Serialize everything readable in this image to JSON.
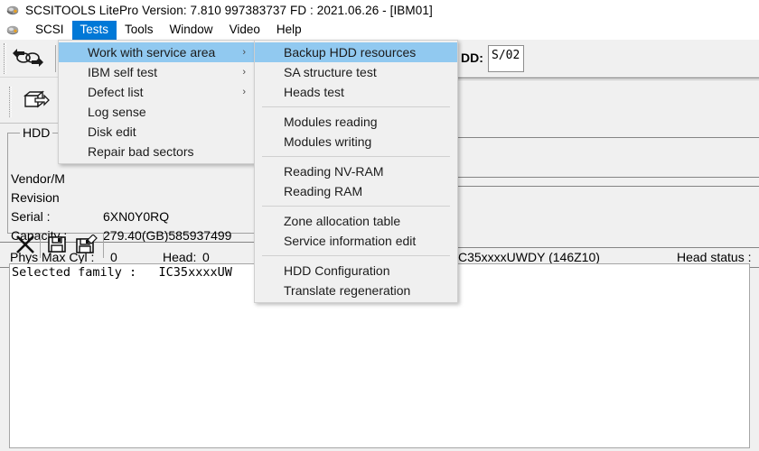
{
  "window": {
    "icon": "scsitools-app-icon",
    "title": "SCSITOOLS LitePro Version: 7.810   997383737  FD : 2021.06.26 - [IBM01]"
  },
  "menubar": {
    "icon": "scsi-doc-icon",
    "items": [
      {
        "label": "SCSI",
        "active": false
      },
      {
        "label": "Tests",
        "active": true
      },
      {
        "label": "Tools",
        "active": false
      },
      {
        "label": "Window",
        "active": false
      },
      {
        "label": "Video",
        "active": false
      },
      {
        "label": "Help",
        "active": false
      }
    ]
  },
  "toolbar": {
    "buttons": [
      {
        "icon": "swap-arrows-icon",
        "name": "rescan-bus-button"
      },
      {
        "icon": "select-drive-icon",
        "name": "select-drive-button"
      }
    ]
  },
  "tests_menu": {
    "items": [
      {
        "label": "Work with service area",
        "submenu": true,
        "highlighted": true
      },
      {
        "label": "IBM self test",
        "submenu": true,
        "highlighted": false
      },
      {
        "label": "Defect list",
        "submenu": true,
        "highlighted": false
      },
      {
        "label": "Log sense",
        "submenu": false,
        "highlighted": false
      },
      {
        "label": "Disk edit",
        "submenu": false,
        "highlighted": false
      },
      {
        "label": "Repair bad sectors",
        "submenu": false,
        "highlighted": false
      }
    ]
  },
  "service_area_menu": {
    "groups": [
      [
        {
          "label": "Backup HDD resources",
          "highlighted": true
        },
        {
          "label": "SA structure test",
          "highlighted": false
        },
        {
          "label": "Heads test",
          "highlighted": false
        }
      ],
      [
        {
          "label": "Modules reading",
          "highlighted": false
        },
        {
          "label": "Modules writing",
          "highlighted": false
        }
      ],
      [
        {
          "label": "Reading NV-RAM",
          "highlighted": false
        },
        {
          "label": "Reading RAM",
          "highlighted": false
        }
      ],
      [
        {
          "label": "Zone allocation table",
          "highlighted": false
        },
        {
          "label": "Service information edit",
          "highlighted": false
        }
      ],
      [
        {
          "label": "HDD Configuration",
          "highlighted": false
        },
        {
          "label": "Translate regeneration",
          "highlighted": false
        }
      ]
    ]
  },
  "hdd_panel": {
    "group_title": "HDD",
    "fields": {
      "vendor_label": "Vendor/M",
      "revision_label": "Revision",
      "serial_label": "Serial :",
      "serial_value": "6XN0Y0RQ",
      "capacity_label": "Capacity :",
      "capacity_value": "279.40(GB)585937499"
    },
    "phys_max_cyl_label": "Phys Max Cyl :",
    "phys_max_cyl_value": "0",
    "head_label": "Head:",
    "head_value": "0"
  },
  "right_panel": {
    "hdd_label": "DD:",
    "hdd_value": "S/02",
    "family_value": "C35xxxxUWDY (146Z10)",
    "head_status_label": "Head status :"
  },
  "log": {
    "lines": [
      "Selected family :   IC35xxxxUW"
    ]
  },
  "log_toolbar": {
    "buttons": [
      {
        "icon": "clear-x-icon",
        "name": "clear-log-button"
      },
      {
        "icon": "save-icon",
        "name": "save-log-button"
      },
      {
        "icon": "save-as-icon",
        "name": "save-log-as-button"
      }
    ]
  },
  "colors": {
    "menu_active": "#0078d7",
    "popup_highlight": "#91c9f0",
    "window_bg": "#f0f0f0"
  }
}
